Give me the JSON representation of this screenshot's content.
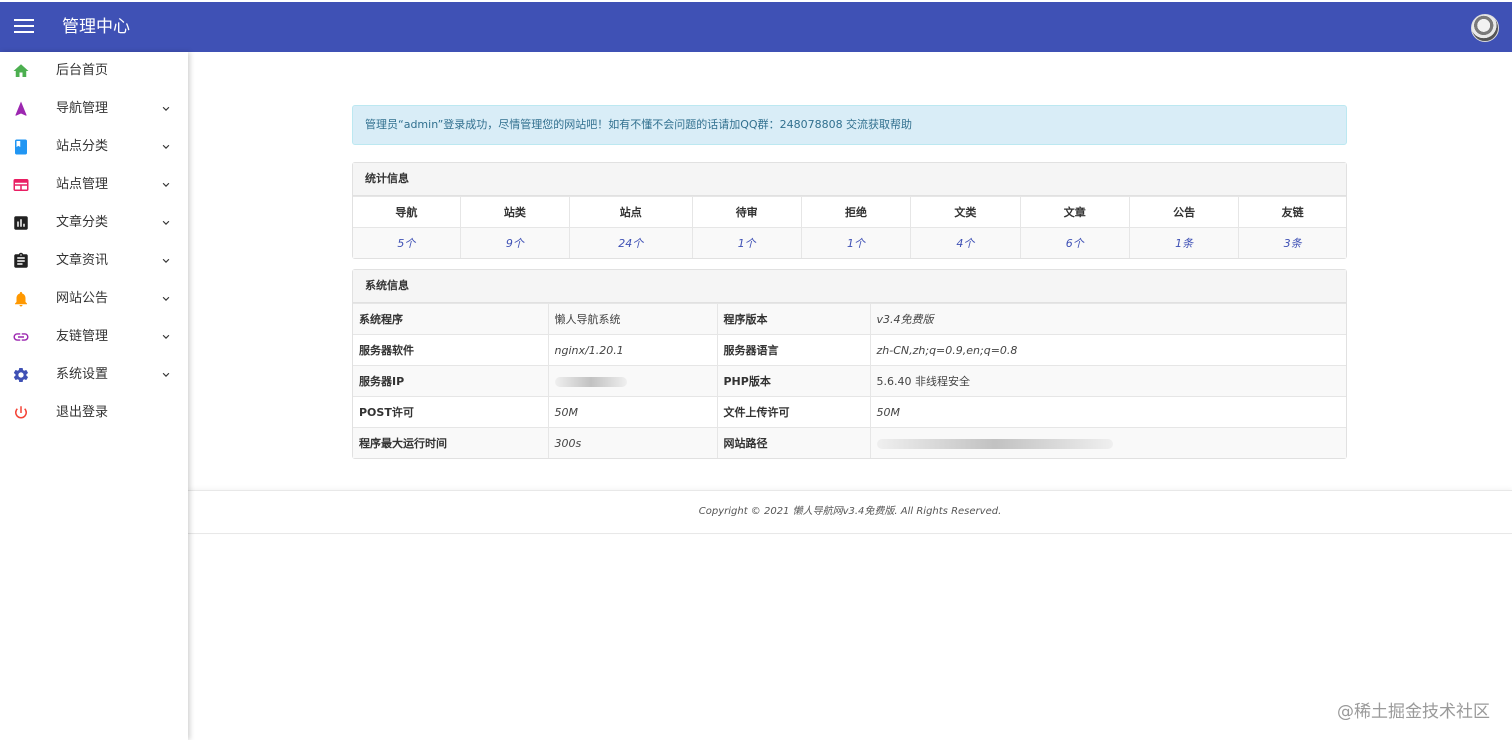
{
  "header": {
    "title": "管理中心"
  },
  "sidebar": {
    "items": [
      {
        "label": "后台首页",
        "icon": "home-icon",
        "color": "#4caf50",
        "expandable": false
      },
      {
        "label": "导航管理",
        "icon": "navigation-icon",
        "color": "#9c27b0",
        "expandable": true
      },
      {
        "label": "站点分类",
        "icon": "book-icon",
        "color": "#2196f3",
        "expandable": true
      },
      {
        "label": "站点管理",
        "icon": "web-icon",
        "color": "#e91e63",
        "expandable": true
      },
      {
        "label": "文章分类",
        "icon": "chart-icon",
        "color": "#212121",
        "expandable": true
      },
      {
        "label": "文章资讯",
        "icon": "clipboard-icon",
        "color": "#212121",
        "expandable": true
      },
      {
        "label": "网站公告",
        "icon": "bell-icon",
        "color": "#ff9800",
        "expandable": true
      },
      {
        "label": "友链管理",
        "icon": "link-icon",
        "color": "#9c27b0",
        "expandable": true
      },
      {
        "label": "系统设置",
        "icon": "gear-icon",
        "color": "#3f51b5",
        "expandable": true
      },
      {
        "label": "退出登录",
        "icon": "power-icon",
        "color": "#f44336",
        "expandable": false
      }
    ]
  },
  "alert": {
    "text": "管理员“admin”登录成功，尽情管理您的网站吧！如有不懂不会问题的话请加QQ群：248078808 交流获取帮助"
  },
  "stats": {
    "title": "统计信息",
    "headers": [
      "导航",
      "站类",
      "站点",
      "待审",
      "拒绝",
      "文类",
      "文章",
      "公告",
      "友链"
    ],
    "values": [
      "5个",
      "9个",
      "24个",
      "1个",
      "1个",
      "4个",
      "6个",
      "1条",
      "3条"
    ]
  },
  "system": {
    "title": "系统信息",
    "rows": [
      [
        "系统程序",
        "懒人导航系统",
        "程序版本",
        "v3.4免费版"
      ],
      [
        "服务器软件",
        "nginx/1.20.1",
        "服务器语言",
        "zh-CN,zh;q=0.9,en;q=0.8"
      ],
      [
        "服务器IP",
        "",
        "PHP版本",
        "5.6.40 非线程安全"
      ],
      [
        "POST许可",
        "50M",
        "文件上传许可",
        "50M"
      ],
      [
        "程序最大运行时间",
        "300s",
        "网站路径",
        ""
      ]
    ]
  },
  "footer": {
    "text": "Copyright © 2021 懒人导航网v3.4免费版. All Rights Reserved."
  },
  "watermark": {
    "text": "@稀土掘金技术社区"
  },
  "colors": {
    "primary": "#3f51b5",
    "alert_bg": "#d9edf7",
    "alert_text": "#31708f"
  }
}
